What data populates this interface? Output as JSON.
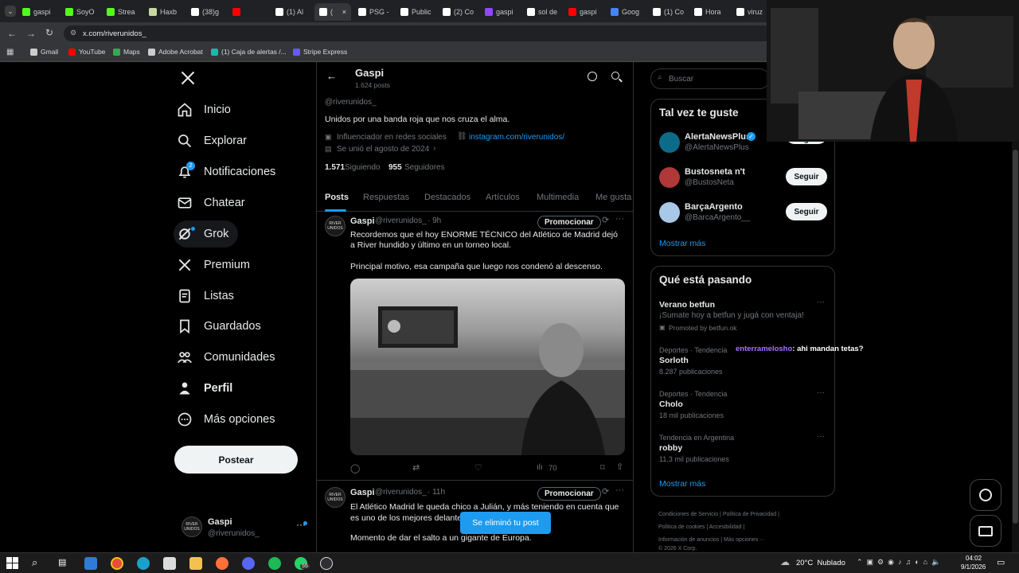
{
  "browser": {
    "tabs": [
      {
        "label": "gaspi",
        "color": "#53fc18"
      },
      {
        "label": "SoyO",
        "color": "#53fc18"
      },
      {
        "label": "Strea",
        "color": "#53fc18"
      },
      {
        "label": "Haxb",
        "color": "#c9d6a3"
      },
      {
        "label": "(38)g",
        "color": "#ffffff"
      },
      {
        "label": "",
        "color": "#ff0000"
      },
      {
        "label": "(1) Al",
        "color": "#ffffff"
      },
      {
        "label": "(",
        "color": "#ffffff"
      },
      {
        "label": "PSG -",
        "color": "#ffffff"
      },
      {
        "label": "Public",
        "color": "#ffffff"
      },
      {
        "label": "(2) Co",
        "color": "#ffffff"
      },
      {
        "label": "gaspi",
        "color": "#9146ff"
      },
      {
        "label": "sol de",
        "color": "#ffffff"
      },
      {
        "label": "gaspi",
        "color": "#ff0000"
      },
      {
        "label": "Goog",
        "color": "#4285f4"
      },
      {
        "label": "(1) Co",
        "color": "#ffffff"
      },
      {
        "label": "Hora",
        "color": "#ffffff"
      },
      {
        "label": "viruz",
        "color": "#ffffff"
      }
    ],
    "url": "x.com/riverunidos_",
    "bookmarks": [
      {
        "label": "Gmail",
        "color": "#cccccc"
      },
      {
        "label": "YouTube",
        "color": "#ff0000"
      },
      {
        "label": "Maps",
        "color": "#34a853"
      },
      {
        "label": "Adobe Acrobat",
        "color": "#cccccc"
      },
      {
        "label": "(1) Caja de alertas /...",
        "color": "#1fb6a6"
      },
      {
        "label": "Stripe Express",
        "color": "#635bff"
      }
    ]
  },
  "nav": {
    "items": [
      {
        "label": "Inicio",
        "icon": "home-icon"
      },
      {
        "label": "Explorar",
        "icon": "search-icon"
      },
      {
        "label": "Notificaciones",
        "icon": "bell-icon",
        "badge": "2"
      },
      {
        "label": "Chatear",
        "icon": "mail-icon"
      },
      {
        "label": "Grok",
        "icon": "grok-icon"
      },
      {
        "label": "Premium",
        "icon": "x-icon"
      },
      {
        "label": "Listas",
        "icon": "list-icon"
      },
      {
        "label": "Guardados",
        "icon": "bookmark-icon"
      },
      {
        "label": "Comunidades",
        "icon": "people-icon"
      },
      {
        "label": "Perfil",
        "icon": "person-icon"
      },
      {
        "label": "Más opciones",
        "icon": "more-circle-icon"
      }
    ],
    "post_label": "Postear",
    "account_name": "Gaspi",
    "account_handle": "@riverunidos_"
  },
  "profile": {
    "header_name": "Gaspi",
    "post_count": "1.624 posts",
    "handle": "@riverunidos_",
    "bio": "Unidos por una banda roja que nos cruza el alma.",
    "category": "Influenciador en redes sociales",
    "link": "instagram.com/riverunidos/",
    "joined": "Se unió el agosto de 2024",
    "following_count": "1.571",
    "following_label": "Siguiendo",
    "followers_count": "955",
    "followers_label": "Seguidores",
    "tabs": [
      "Posts",
      "Respuestas",
      "Destacados",
      "Artículos",
      "Multimedia",
      "Me gusta"
    ]
  },
  "tweets": [
    {
      "name": "Gaspi",
      "handle": "@riverunidos_",
      "time": "· 9h",
      "promo": "Promocionar",
      "text1": "Recordemos que el hoy ENORME TÉCNICO del Atlético de Madrid dejó a River hundido y último en un torneo local.",
      "text2": "Principal motivo, esa campaña que luego nos condenó al descenso.",
      "views": "70"
    },
    {
      "name": "Gaspi",
      "handle": "@riverunidos_",
      "time": "· 11h",
      "promo": "Promocionar",
      "text1": "El Atlético Madrid le queda chico a Julián, y más teniendo en cuenta que es uno de los mejores delanteros",
      "text2": "Momento de dar el salto a un gigante de Europa."
    }
  ],
  "toast": "Se eliminó tu post",
  "search": {
    "placeholder": "Buscar"
  },
  "suggestions": {
    "title": "Tal vez te guste",
    "users": [
      {
        "name": "AlertaNewsPlus",
        "handle": "@AlertaNewsPlus",
        "btn": "Seguir",
        "verified": true
      },
      {
        "name": "Bustosneta n't",
        "handle": "@BustosNeta",
        "btn": "Seguir"
      },
      {
        "name": "BarçaArgento",
        "handle": "@BarcaArgento__",
        "btn": "Seguir"
      }
    ],
    "more": "Mostrar más"
  },
  "trends": {
    "title": "Qué está pasando",
    "promoted": {
      "name": "Verano betfun",
      "desc": "¡Sumate hoy a betfun y jugá con ventaja!",
      "by": "Promoted by betfun.ok"
    },
    "items": [
      {
        "cat": "Deportes · Tendencia",
        "name": "Sorloth",
        "count": "8.287 publicaciones"
      },
      {
        "cat": "Deportes · Tendencia",
        "name": "Cholo",
        "count": "18 mil publicaciones"
      },
      {
        "cat": "Tendencia en Argentina",
        "name": "robby",
        "count": "11,3 mil publicaciones"
      }
    ],
    "more": "Mostrar más"
  },
  "footer": {
    "links": [
      "Condiciones de Servicio",
      "Política de Privacidad",
      "Política de cookies",
      "Accesibilidad",
      "Información de anuncios",
      "Más opciones ···"
    ],
    "copyright": "© 2026 X Corp."
  },
  "chat_overlay": {
    "user": "enterramelosho",
    "message": ": ahi mandan tetas?"
  },
  "taskbar": {
    "weather": "20°C  Nublado",
    "time": "04:02",
    "date": "9/1/2026",
    "whatsapp_badge": "55"
  }
}
